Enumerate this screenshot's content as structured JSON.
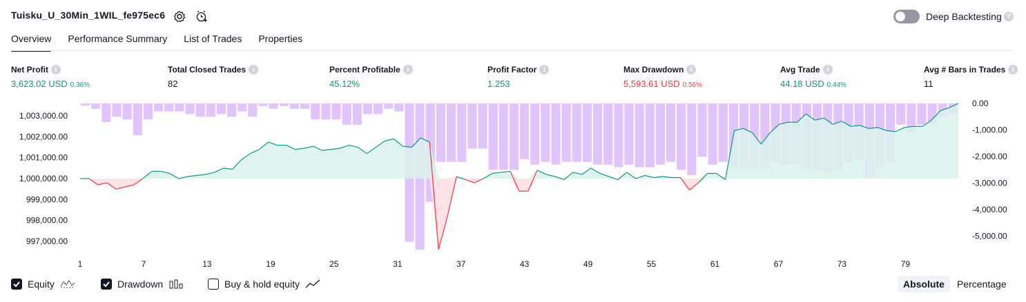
{
  "header": {
    "title": "Tuisku_U_30Min_1WIL_fe975ec6",
    "deep_backtesting_label": "Deep Backtesting",
    "deep_backtesting_on": false
  },
  "tabs": [
    {
      "label": "Overview",
      "active": true
    },
    {
      "label": "Performance Summary",
      "active": false
    },
    {
      "label": "List of Trades",
      "active": false
    },
    {
      "label": "Properties",
      "active": false
    }
  ],
  "metrics": [
    {
      "label": "Net Profit",
      "value": "3,623.02 USD",
      "pct": "0.36%",
      "tone": "pos"
    },
    {
      "label": "Total Closed Trades",
      "value": "82",
      "pct": "",
      "tone": "neu"
    },
    {
      "label": "Percent Profitable",
      "value": "45.12%",
      "pct": "",
      "tone": "pos"
    },
    {
      "label": "Profit Factor",
      "value": "1.253",
      "pct": "",
      "tone": "pos"
    },
    {
      "label": "Max Drawdown",
      "value": "5,593.61 USD",
      "pct": "0.56%",
      "tone": "neg"
    },
    {
      "label": "Avg Trade",
      "value": "44.18 USD",
      "pct": "0.44%",
      "tone": "pos"
    },
    {
      "label": "Avg # Bars in Trades",
      "value": "11",
      "pct": "",
      "tone": "neu"
    }
  ],
  "chart_data": {
    "type": "line",
    "baseline": 1000000,
    "left_axis_ticks": [
      "1,003,000.00",
      "1,002,000.00",
      "1,001,000.00",
      "1,000,000.00",
      "999,000.00",
      "998,000.00",
      "997,000.00"
    ],
    "left_ylim": [
      996600,
      1003600
    ],
    "right_axis_ticks": [
      "0.00",
      "-1,000.00",
      "-2,000.00",
      "-3,000.00",
      "-4,000.00",
      "-5,000.00"
    ],
    "right_ylim": [
      -5500,
      0
    ],
    "x_ticks": [
      "1",
      "7",
      "13",
      "19",
      "25",
      "31",
      "37",
      "43",
      "49",
      "55",
      "61",
      "67",
      "73",
      "79"
    ],
    "x_count": 84,
    "series": [
      {
        "values": [
          1000000,
          1000000,
          999700,
          999800,
          999500,
          999600,
          999700,
          1000000,
          1000350,
          1000350,
          1000250,
          1000000,
          1000100,
          1000150,
          1000200,
          1000300,
          1000500,
          1000450,
          1000900,
          1001200,
          1001400,
          1001750,
          1001600,
          1001600,
          1001400,
          1001450,
          1001550,
          1001350,
          1001400,
          1001450,
          1001600,
          1001500,
          1001200,
          1001500,
          1001800,
          1001900,
          1001550,
          1001500,
          1001950,
          1001750,
          996600,
          998200,
          1000100,
          999950,
          999800,
          1000000,
          1000250,
          1000300,
          1000350,
          999400,
          999400,
          1000400,
          1000200,
          1000100,
          999950,
          1000300,
          1000200,
          1000500,
          1000250,
          1000100,
          999950,
          1000300,
          1000000,
          1000150,
          1000050,
          1000100,
          1000050,
          1000050,
          999450,
          999800,
          1000250,
          1000250,
          999950,
          1002300,
          1002400,
          1002200,
          1001650,
          1002200,
          1002600,
          1002700,
          1002700,
          1003100,
          1002800,
          1002900,
          1002600,
          1002750,
          1002500,
          1002550,
          1002400,
          1002450,
          1002300,
          1002250,
          1002450,
          1002500,
          1002500,
          1002800,
          1003250,
          1003400,
          1003600
        ]
      },
      {
        "values": [
          -80,
          -200,
          -700,
          -500,
          -600,
          -1200,
          -600,
          -300,
          -300,
          -300,
          -400,
          -500,
          -500,
          -400,
          -500,
          -300,
          -500,
          -100,
          -200,
          -100,
          -200,
          -200,
          -600,
          -600,
          -600,
          -800,
          -800,
          -400,
          -400,
          -200,
          -300,
          -5000,
          -5500,
          -3700,
          -2200,
          -2200,
          -2200,
          -2200,
          -1700,
          -1700,
          -2500,
          -2500,
          -2500,
          -2100,
          -2300,
          -2200,
          -2300,
          -2200,
          -2200,
          -2200,
          -2300,
          -2300,
          -2400,
          -2300,
          -2400,
          -2400,
          -2300,
          -2200,
          -2500,
          -2700,
          -2000,
          -2300,
          -2200,
          -2400,
          -2400,
          -2400,
          -2400,
          -2200,
          -2300,
          -2300,
          -2400,
          -2500,
          -2600,
          -2500,
          -2200,
          -2100,
          -2800,
          -2400,
          -2200,
          -800,
          -1100,
          -800,
          -800,
          -500,
          -400,
          -200
        ],
        "bar_values": [
          -80,
          -200,
          -700,
          -500,
          -600,
          -1200,
          -600,
          -300,
          -300,
          -300,
          -400,
          -500,
          -500,
          -400,
          -500,
          -300,
          -500,
          -100,
          -200,
          -100,
          -200,
          -200,
          -600,
          -600,
          -600,
          -800,
          -800,
          -400,
          -400,
          -200,
          -300,
          -5400,
          -5500,
          -3700,
          -2200,
          -2200,
          -2200,
          -1700,
          -1700,
          -2500,
          -2500,
          -2500,
          -2100,
          -2300,
          -2200,
          -2300,
          -2200,
          -2200,
          -2200,
          -2300,
          -2300,
          -2400,
          -2300,
          -2400,
          -2400,
          -2300,
          -2200,
          -2500,
          -2700,
          -2000,
          -2300,
          -2200,
          -2400,
          -2400,
          -2400,
          -2400,
          -2200,
          -2300,
          -2300,
          -2400,
          -2500,
          -2600,
          -2500,
          -2200,
          -2100,
          -2800,
          -2400,
          -2200,
          -800,
          -1100,
          -800,
          -800,
          -500,
          -400,
          -200,
          -100
        ]
      }
    ],
    "drawdown_bars": [
      -80,
      -200,
      -700,
      -500,
      -600,
      -1200,
      -600,
      -300,
      -300,
      -300,
      -400,
      -500,
      -500,
      -400,
      -500,
      -300,
      -500,
      -100,
      -200,
      -100,
      -200,
      -200,
      -600,
      -600,
      -600,
      -800,
      -800,
      -400,
      -400,
      -200,
      -300,
      -5200,
      -5500,
      -3700,
      -2200,
      -2200,
      -2200,
      -1700,
      -1700,
      -2500,
      -2500,
      -2500,
      -2100,
      -2300,
      -2200,
      -2300,
      -2200,
      -2200,
      -2200,
      -2300,
      -2300,
      -2400,
      -2300,
      -2400,
      -2400,
      -2300,
      -2200,
      -2500,
      -2700,
      -2000,
      -2300,
      -2200,
      -2400,
      -2400,
      -2400,
      -2400,
      -2200,
      -2300,
      -2300,
      -2400,
      -2500,
      -2600,
      -2500,
      -2200,
      -2100,
      -2800,
      -2400,
      -2200,
      -800,
      -1100,
      -800,
      -800,
      -500,
      -400
    ],
    "colors": {
      "equity_up": "#089981",
      "equity_down": "#f23645",
      "equity_fill": "#daf2ec",
      "equity_fill_down": "#fde0e2",
      "drawdown": "#e1c4fb",
      "drawdown_overlap": "#b7a3e0"
    }
  },
  "legend": {
    "equity_label": "Equity",
    "equity_checked": true,
    "drawdown_label": "Drawdown",
    "drawdown_checked": true,
    "buyhold_label": "Buy & hold equity",
    "buyhold_checked": false
  },
  "view_toggle": {
    "absolute_label": "Absolute",
    "percentage_label": "Percentage",
    "active": "absolute"
  }
}
